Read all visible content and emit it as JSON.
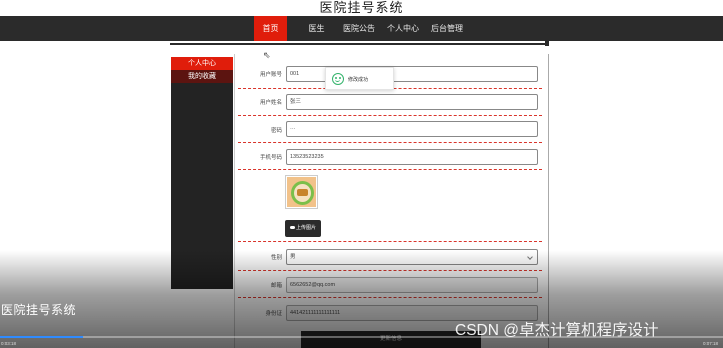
{
  "site": {
    "title": "医院挂号系统"
  },
  "nav": {
    "items": [
      {
        "label": "首页",
        "active": true
      },
      {
        "label": "医生",
        "active": false
      },
      {
        "label": "医院公告",
        "active": false
      },
      {
        "label": "个人中心",
        "active": false
      },
      {
        "label": "后台管理",
        "active": false
      }
    ]
  },
  "sidebar": {
    "items": [
      {
        "label": "个人中心",
        "active": true
      },
      {
        "label": "我的收藏",
        "active": false
      }
    ]
  },
  "form": {
    "account": {
      "label": "用户账号",
      "value": "001"
    },
    "name": {
      "label": "用户姓名",
      "value": "张三"
    },
    "password": {
      "label": "密码",
      "value": "···"
    },
    "phone": {
      "label": "手机号码",
      "value": "13523523235"
    },
    "upload_label": "上传图片",
    "gender": {
      "label": "性别",
      "value": "男"
    },
    "email": {
      "label": "邮箱",
      "value": "6562652@qq.com"
    },
    "idcard": {
      "label": "身份证",
      "value": "441421111111111111"
    },
    "save_label": "更新信息"
  },
  "toast": {
    "message": "修改成功"
  },
  "video": {
    "title": "医院挂号系统",
    "time_current": "0:03:18",
    "time_total": "0:07:18",
    "progress": 0.115
  },
  "watermark": "CSDN @卓杰计算机程序设计",
  "colors": {
    "accent": "#e01d0b",
    "nav_bg": "#2b2b2b",
    "toast_icon": "#33b36b",
    "progress": "#2f8bff"
  }
}
